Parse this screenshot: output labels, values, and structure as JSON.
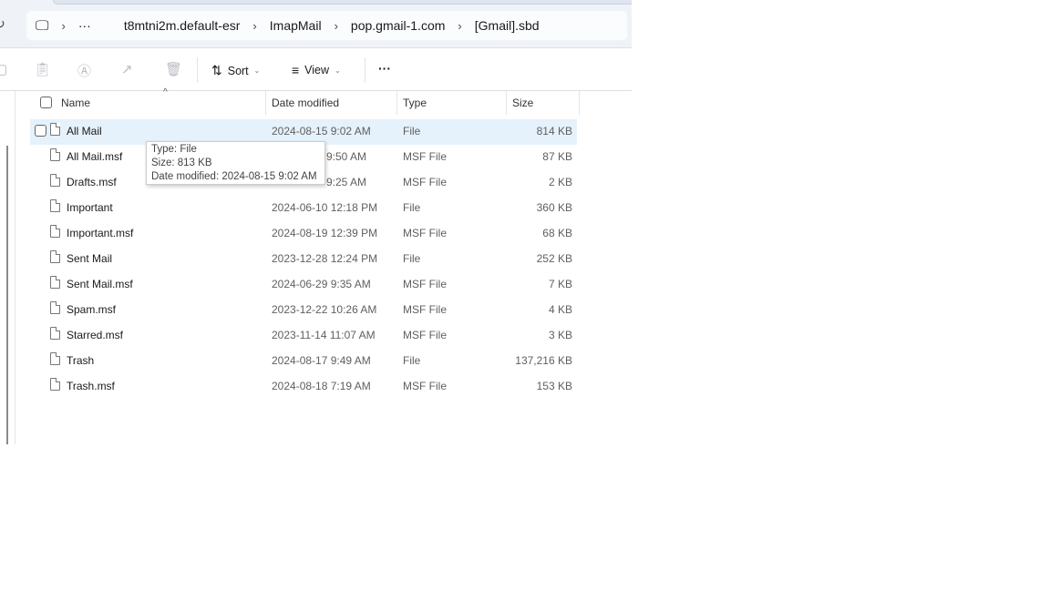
{
  "address_bar": {
    "crumbs": [
      "t8mtni2m.default-esr",
      "ImapMail",
      "pop.gmail-1.com",
      "[Gmail].sbd"
    ],
    "overflow": "···"
  },
  "toolbar": {
    "sort_label": "Sort",
    "view_label": "View",
    "more_label": "···"
  },
  "columns": {
    "name": "Name",
    "date": "Date modified",
    "type": "Type",
    "size": "Size"
  },
  "files": [
    {
      "name": "All Mail",
      "date": "2024-08-15 9:02 AM",
      "type": "File",
      "size": "814 KB",
      "selected": true
    },
    {
      "name": "All Mail.msf",
      "date": "9:50 AM",
      "type": "MSF File",
      "size": "87 KB"
    },
    {
      "name": "Drafts.msf",
      "date": "9:25 AM",
      "type": "MSF File",
      "size": "2 KB"
    },
    {
      "name": "Important",
      "date": "2024-06-10 12:18 PM",
      "type": "File",
      "size": "360 KB"
    },
    {
      "name": "Important.msf",
      "date": "2024-08-19 12:39 PM",
      "type": "MSF File",
      "size": "68 KB"
    },
    {
      "name": "Sent Mail",
      "date": "2023-12-28 12:24 PM",
      "type": "File",
      "size": "252 KB"
    },
    {
      "name": "Sent Mail.msf",
      "date": "2024-06-29 9:35 AM",
      "type": "MSF File",
      "size": "7 KB"
    },
    {
      "name": "Spam.msf",
      "date": "2023-12-22 10:26 AM",
      "type": "MSF File",
      "size": "4 KB"
    },
    {
      "name": "Starred.msf",
      "date": "2023-11-14 11:07 AM",
      "type": "MSF File",
      "size": "3 KB"
    },
    {
      "name": "Trash",
      "date": "2024-08-17 9:49 AM",
      "type": "File",
      "size": "137,216 KB"
    },
    {
      "name": "Trash.msf",
      "date": "2024-08-18 7:19 AM",
      "type": "MSF File",
      "size": "153 KB"
    }
  ],
  "tooltip": {
    "type": "Type: File",
    "size": "Size: 813 KB",
    "date": "Date modified: 2024-08-15 9:02 AM"
  }
}
